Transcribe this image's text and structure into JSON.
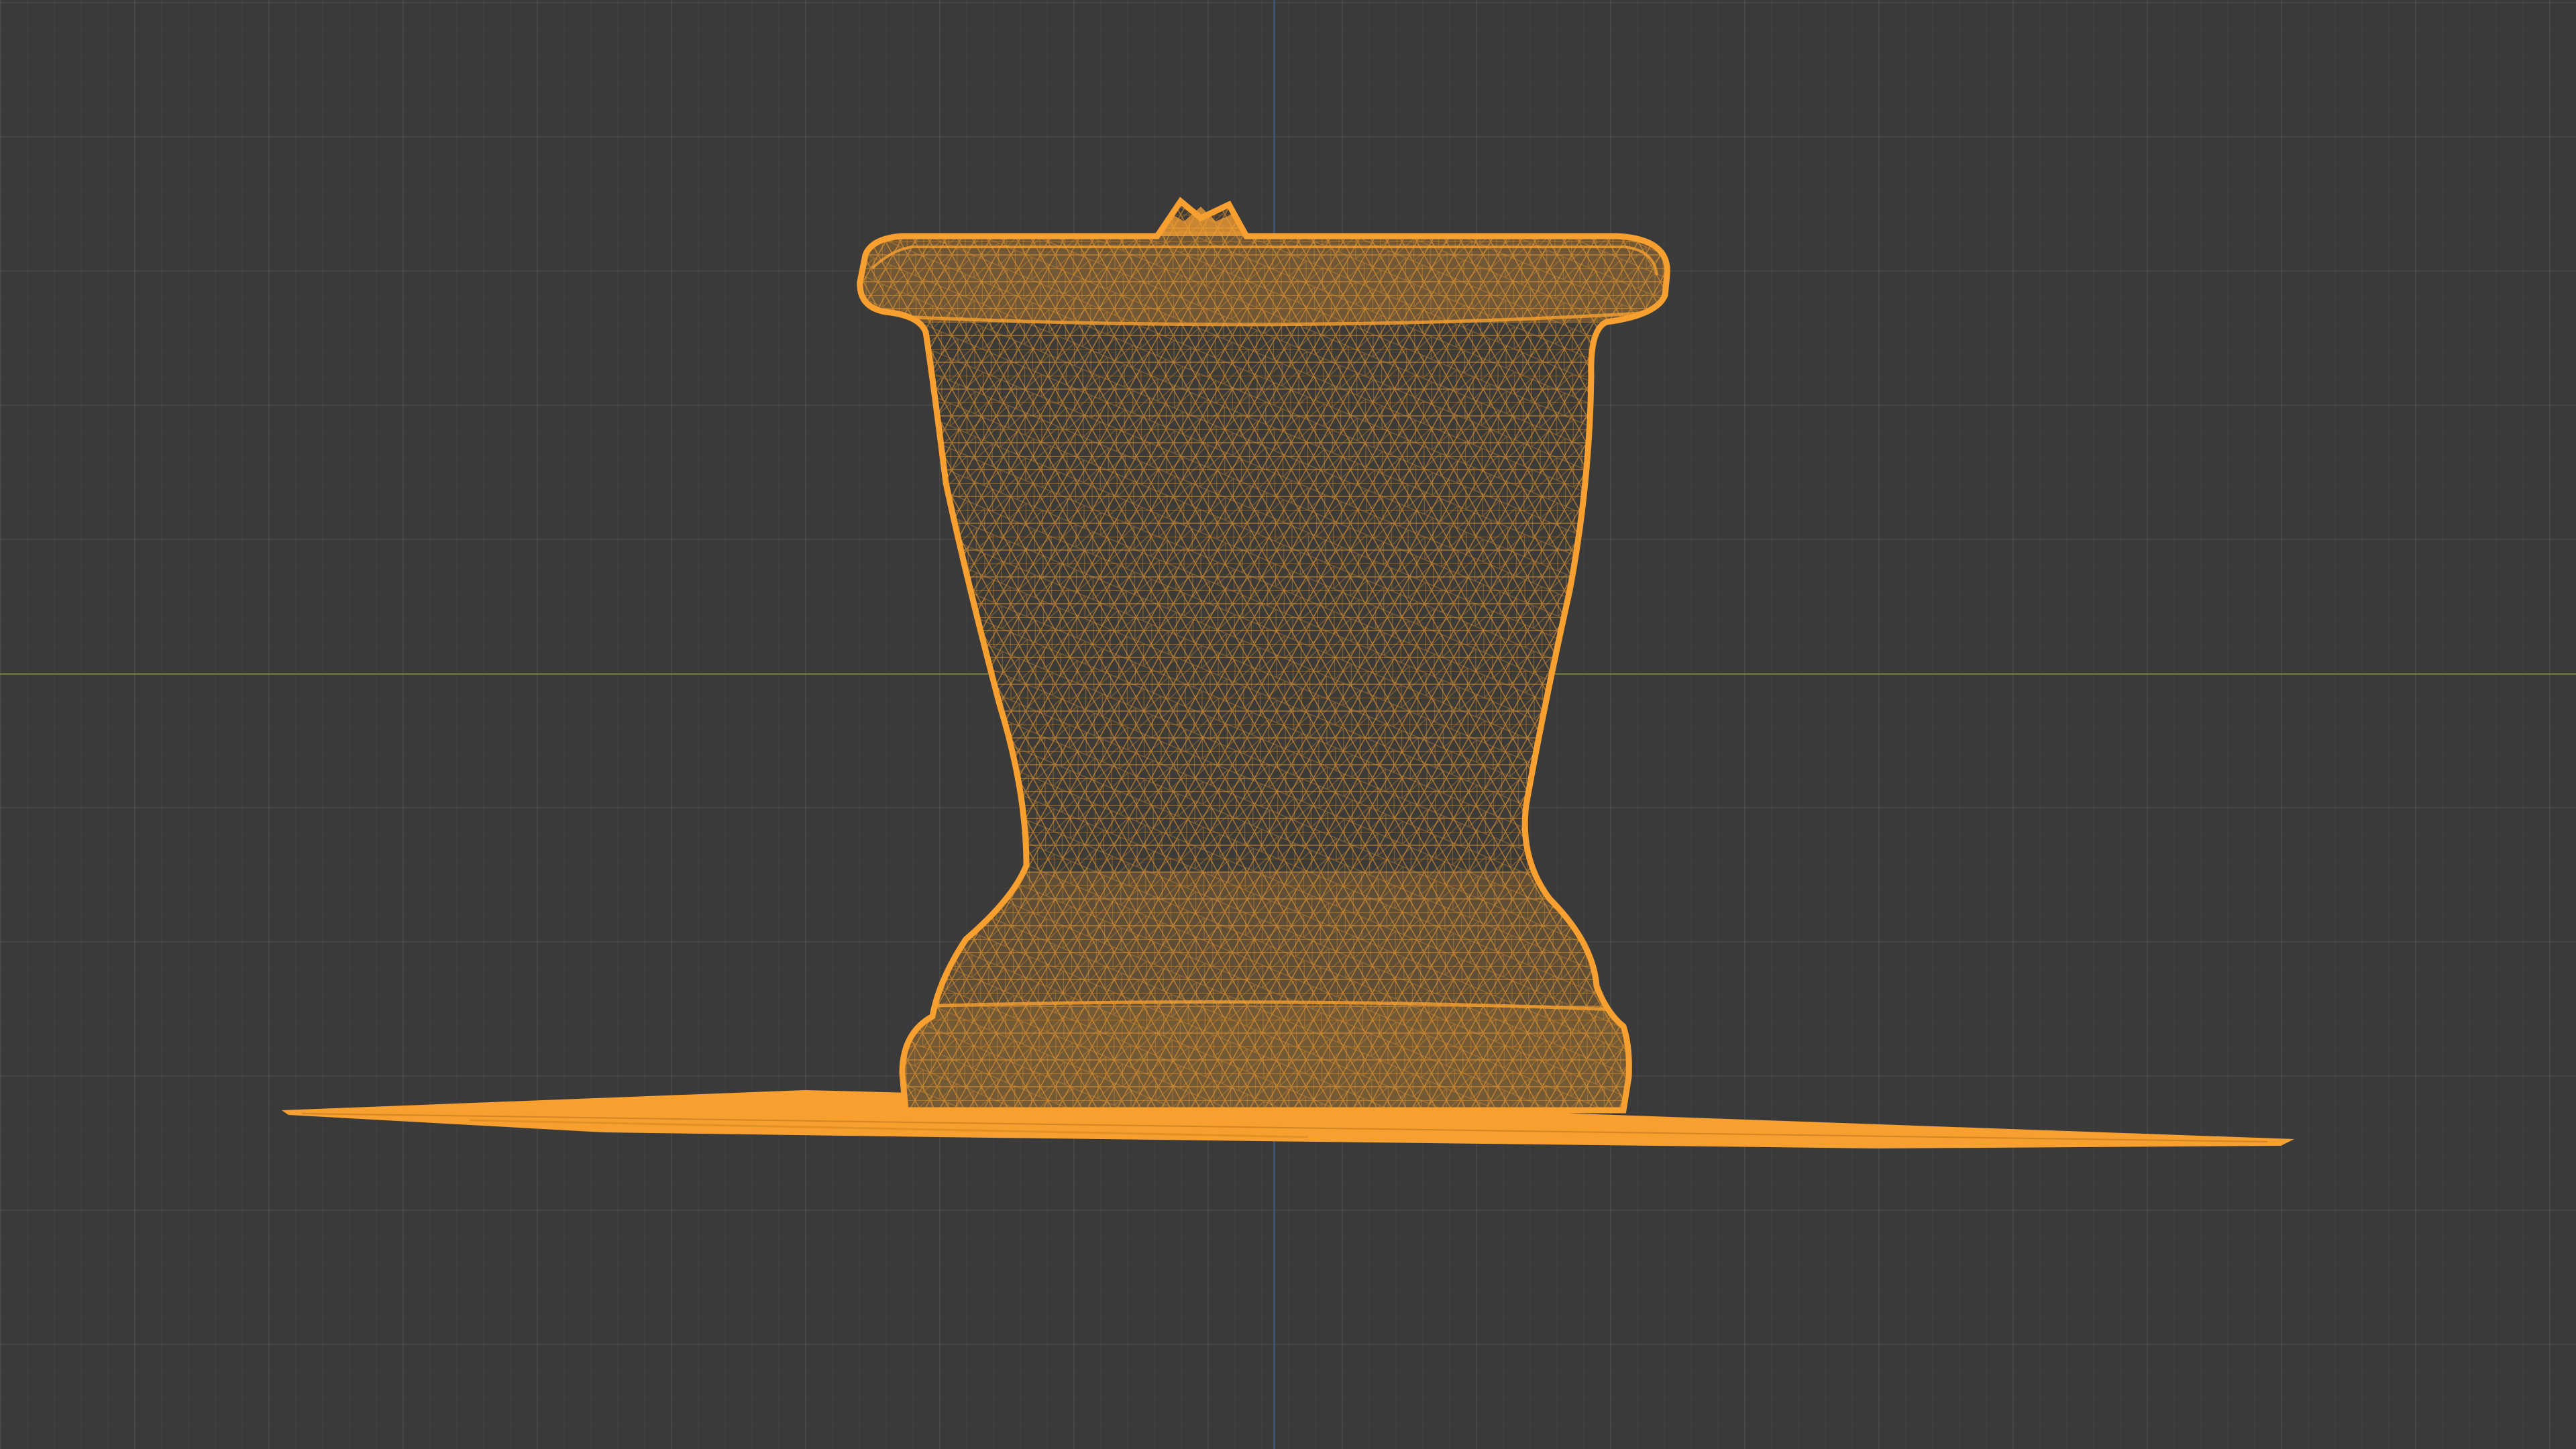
{
  "app": {
    "view": "3D viewport",
    "display_mode": "wireframe"
  },
  "viewport": {
    "background_color": "#3a3a3a",
    "grid_color": "#444444",
    "x_axis_color": "#6f7a3c",
    "z_axis_color": "#3f5f86"
  },
  "object": {
    "kind": "urn-shaped planter mesh on a flat base scan",
    "selected": true,
    "wire_color": "#f7a030",
    "fill_color": "#3a3a3a"
  }
}
